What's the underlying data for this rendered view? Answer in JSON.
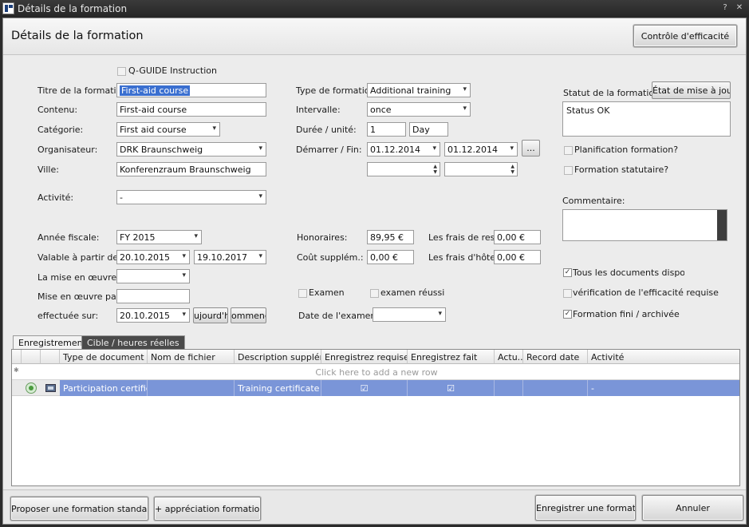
{
  "window": {
    "title": "Détails de la formation",
    "help_glyph": "?",
    "close_glyph": "✕"
  },
  "header": {
    "title": "Détails de la formation",
    "efficacite_button": "Contrôle d'efficacité"
  },
  "form": {
    "qguide_label": "Q-GUIDE Instruction",
    "qguide_checked": false,
    "titre_label": "Titre de la formation:",
    "titre_value": "First-aid course",
    "contenu_label": "Contenu:",
    "contenu_value": "First-aid course",
    "categorie_label": "Catégorie:",
    "categorie_value": "First aid course",
    "organisateur_label": "Organisateur:",
    "organisateur_value": "DRK Braunschweig",
    "ville_label": "Ville:",
    "ville_value": "Konferenzraum Braunschweig",
    "activite_label": "Activité:",
    "activite_value": "-",
    "annee_label": "Année fiscale:",
    "annee_value": "FY 2015",
    "valable_label": "Valable à partir de:",
    "valable_from": "20.10.2015",
    "valable_to": "19.10.2017",
    "mise_oeuvre_label": "La mise en œuvre de:",
    "mise_oeuvre_value": "",
    "mise_oeuvre_par_label": "Mise en œuvre par:",
    "mise_oeuvre_par_value": "",
    "effectuee_label": "effectuée sur:",
    "effectuee_value": "20.10.2015",
    "aujourdhui_button": "ujourd'h",
    "commencer_button": "ommenc",
    "type_label": "Type de formation:",
    "type_value": "Additional training",
    "intervalle_label": "Intervalle:",
    "intervalle_value": "once",
    "duree_label": "Durée / unité:",
    "duree_value": "1",
    "unite_value": "Day",
    "demarrer_label": "Démarrer / Fin:",
    "demarrer_value": "01.12.2014",
    "fin_value": "01.12.2014",
    "ellipsis_button": "...",
    "honoraires_label": "Honoraires:",
    "honoraires_value": "89,95 €",
    "frais_rest_label": "Les frais de rest.:",
    "frais_rest_value": "0,00 €",
    "cout_label": "Coût supplém.:",
    "cout_value": "0,00 €",
    "frais_hotel_label": "Les frais d'hôtel:",
    "frais_hotel_value": "0,00 €",
    "examen_label": "Examen",
    "examen_reussi_label": "examen réussi",
    "date_examen_label": "Date de l'examen:",
    "date_examen_value": ""
  },
  "right": {
    "statut_label": "Statut de la formation:",
    "etat_button": "État de mise à jour",
    "status_text": "Status OK",
    "planification_label": "Planification formation?",
    "statutaire_label": "Formation statutaire?",
    "commentaire_label": "Commentaire:",
    "docs_label": "Tous les documents disponibles",
    "verification_label": "vérification de l'efficacité requise",
    "fini_label": "Formation fini / archivée",
    "check_glyph": "✓"
  },
  "tabs": [
    {
      "label": "Enregistrements"
    },
    {
      "label": "Cible / heures réelles"
    }
  ],
  "grid": {
    "columns": [
      "Type de document",
      "Nom de fichier",
      "Description supplém...",
      "Enregistrez requise",
      "Enregistrez fait",
      "Actu...",
      "Record date",
      "Activité"
    ],
    "new_row_text": "Click here to add a new row",
    "new_row_glyph": "✱",
    "row_pointer": "›",
    "rows": [
      {
        "type": "Participation certificate",
        "file": "",
        "description": "Training certificate",
        "requise": "☑",
        "fait": "☑",
        "actu": "",
        "record_date": "",
        "activite": "-"
      }
    ]
  },
  "footer": {
    "proposer_button": "Proposer une formation standard",
    "appreciation_button": "+ appréciation formation",
    "enregistrer_button": "Enregistrer une formation",
    "annuler_button": "Annuler"
  }
}
